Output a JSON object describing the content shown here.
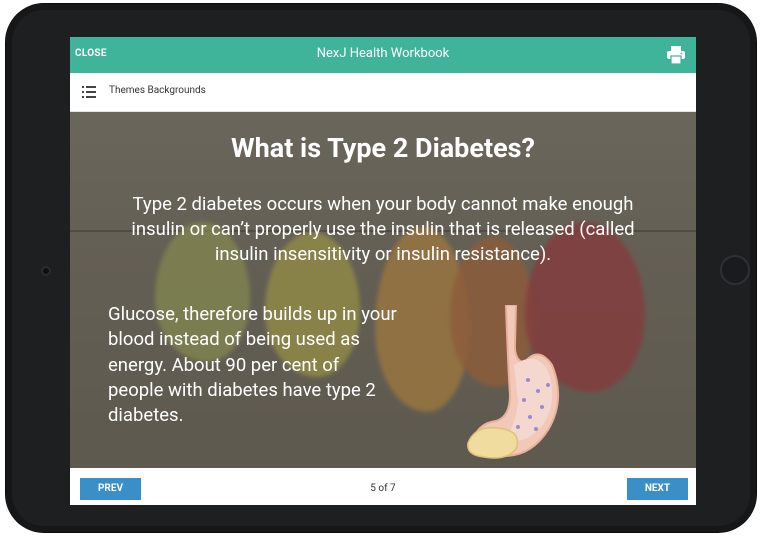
{
  "header": {
    "close_label": "CLOSE",
    "title": "NexJ Health Workbook",
    "print_icon": "printer-icon"
  },
  "subheader": {
    "menu_icon": "list-icon",
    "themes_label": "Themes Backgrounds"
  },
  "content": {
    "heading": "What is Type 2 Diabetes?",
    "intro": "Type 2 diabetes occurs when your body cannot make enough insulin or can’t properly use the insulin that is released (called insulin insensitivity or insulin resistance).",
    "body": "Glucose, therefore builds up in your blood instead of being used as energy. About 90 per cent of people with diabetes have type 2 diabetes.",
    "illustration": "stomach-icon"
  },
  "footer": {
    "prev_label": "PREV",
    "page_indicator": "5 of 7",
    "next_label": "NEXT"
  },
  "colors": {
    "header_bg": "#3fb49a",
    "button_bg": "#3a8fc6",
    "bezel": "#1e1f21"
  }
}
